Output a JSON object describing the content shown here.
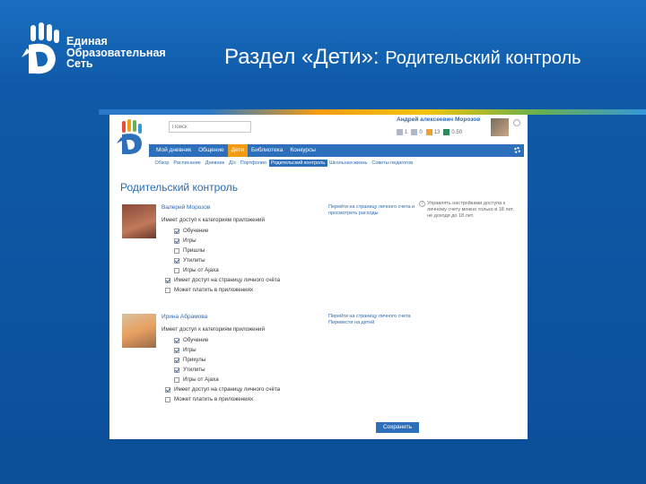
{
  "slide": {
    "logo_lines": [
      "Единая",
      "Образовательная",
      "Сеть"
    ],
    "title_main": "Раздел «Дети»:",
    "title_sub": "Родительский контроль"
  },
  "site": {
    "search_placeholder": "Поиск",
    "user_name": "Андрей алексеевич Морозов",
    "counters": [
      "1",
      "0",
      "13",
      "0.50"
    ],
    "nav": [
      "Мой дневник",
      "Общение",
      "Дети",
      "Библиотека",
      "Конкурсы"
    ],
    "nav_active": 2,
    "subnav": [
      "Обзор",
      "Расписание",
      "Дневник",
      "Д/з",
      "Портфолио",
      "Родительский контроль",
      "Школьная жизнь",
      "Советы педагогов"
    ],
    "subnav_active": 5,
    "page_title": "Родительский контроль",
    "children": [
      {
        "name": "Валерий Морозов",
        "access_label": "Имеет доступ к категориям приложений",
        "categories": [
          {
            "label": "Обучение",
            "checked": true
          },
          {
            "label": "Игры",
            "checked": true
          },
          {
            "label": "Пришлы",
            "checked": false
          },
          {
            "label": "Утилиты",
            "checked": true
          },
          {
            "label": "Игры от Ajaxa",
            "checked": false
          }
        ],
        "page_access": {
          "label": "Имеет доступ на страницу личного счёта",
          "checked": true
        },
        "can_pay": {
          "label": "Может платить в приложениях",
          "checked": false
        },
        "links": "Перейти на страницу личного счета и просмотреть расходы"
      },
      {
        "name": "Ирина Абрамова",
        "access_label": "Имеет доступ к категориям приложений",
        "categories": [
          {
            "label": "Обучение",
            "checked": true
          },
          {
            "label": "Игры",
            "checked": true
          },
          {
            "label": "Прикулы",
            "checked": true
          },
          {
            "label": "Утилиты",
            "checked": true
          },
          {
            "label": "Игры от Ajaxa",
            "checked": false
          }
        ],
        "page_access": {
          "label": "Имеет доступ на страницу личного счёта",
          "checked": true
        },
        "can_pay": {
          "label": "Может платить в приложениях",
          "checked": false
        },
        "links": "Перейти на страницу личного счета Перевести на детей"
      }
    ],
    "info_text": "Управлять настройками доступа к личному счету можно только в 18 лет, не доходя до 18 лет.",
    "save_label": "Сохранить"
  },
  "colors": {
    "accent": "#2d6fba",
    "active_tab": "#f39c12",
    "link": "#2a6ab5"
  }
}
